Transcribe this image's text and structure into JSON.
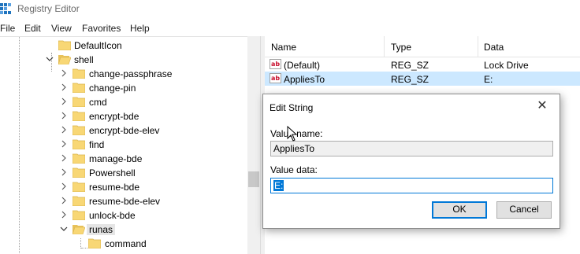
{
  "window": {
    "title": "Registry Editor"
  },
  "menu": [
    "File",
    "Edit",
    "View",
    "Favorites",
    "Help"
  ],
  "tree": {
    "items": [
      {
        "label": "DefaultIcon",
        "expander": "none",
        "level": 2,
        "selected": false
      },
      {
        "label": "shell",
        "expander": "expanded",
        "level": 1,
        "selected": false
      },
      {
        "label": "change-passphrase",
        "expander": "collapsed",
        "level": 2,
        "selected": false
      },
      {
        "label": "change-pin",
        "expander": "collapsed",
        "level": 2,
        "selected": false
      },
      {
        "label": "cmd",
        "expander": "collapsed",
        "level": 2,
        "selected": false
      },
      {
        "label": "encrypt-bde",
        "expander": "collapsed",
        "level": 2,
        "selected": false
      },
      {
        "label": "encrypt-bde-elev",
        "expander": "collapsed",
        "level": 2,
        "selected": false
      },
      {
        "label": "find",
        "expander": "collapsed",
        "level": 2,
        "selected": false
      },
      {
        "label": "manage-bde",
        "expander": "collapsed",
        "level": 2,
        "selected": false
      },
      {
        "label": "Powershell",
        "expander": "collapsed",
        "level": 2,
        "selected": false
      },
      {
        "label": "resume-bde",
        "expander": "collapsed",
        "level": 2,
        "selected": false
      },
      {
        "label": "resume-bde-elev",
        "expander": "collapsed",
        "level": 2,
        "selected": false
      },
      {
        "label": "unlock-bde",
        "expander": "collapsed",
        "level": 2,
        "selected": false
      },
      {
        "label": "runas",
        "expander": "expanded",
        "level": 2,
        "selected": true
      },
      {
        "label": "command",
        "expander": "none",
        "level": 3,
        "selected": false
      }
    ]
  },
  "list": {
    "columns": [
      "Name",
      "Type",
      "Data"
    ],
    "rows": [
      {
        "icon": "string-value-icon",
        "name": "(Default)",
        "type": "REG_SZ",
        "data": "Lock Drive",
        "selected": false
      },
      {
        "icon": "string-value-icon",
        "name": "AppliesTo",
        "type": "REG_SZ",
        "data": "E:",
        "selected": true
      }
    ]
  },
  "dialog": {
    "title": "Edit String",
    "value_name_label": "Value name:",
    "value_name": "AppliesTo",
    "value_data_label": "Value data:",
    "value_data": "E:",
    "ok_label": "OK",
    "cancel_label": "Cancel"
  },
  "colors": {
    "selection": "#cce8ff",
    "accent": "#0078d7",
    "folder": "#f8d775"
  }
}
